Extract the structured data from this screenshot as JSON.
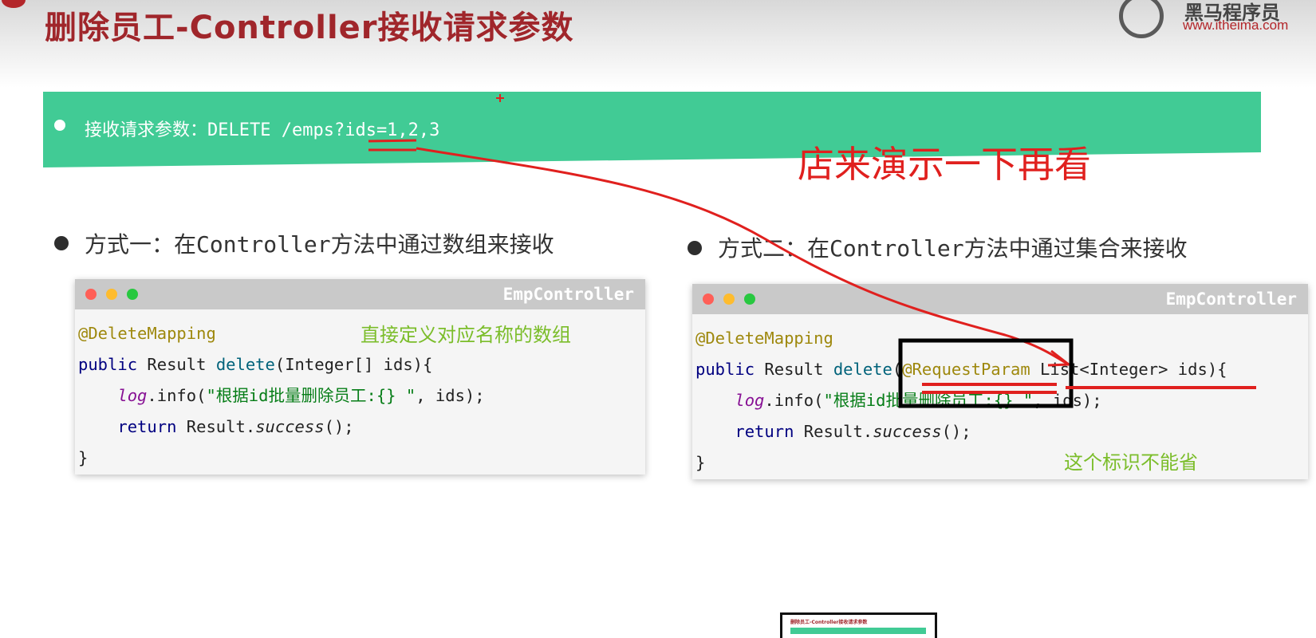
{
  "title": "删除员工-Controller接收请求参数",
  "logo": {
    "name": "黑马程序员",
    "url": "www.itheima.com"
  },
  "banner": {
    "label": "接收请求参数：DELETE",
    "path": "/emps?ids=1,2,3"
  },
  "handwritten_note": "店来演示一下再看",
  "method1": {
    "heading": "方式一：在Controller方法中通过数组来接收",
    "window_title": "EmpController",
    "note": "直接定义对应名称的数组",
    "code": {
      "annotation": "@DeleteMapping",
      "kw_public": "public",
      "type_result": " Result ",
      "method_name": "delete",
      "params": "(Integer[] ids){",
      "indent": "    ",
      "log": "log",
      "info": ".info(",
      "log_string": "\"根据id批量删除员工:{} \"",
      "log_rest": ", ids);",
      "kw_return": "return",
      "result_call": " Result.",
      "success": "success",
      "end_call": "();",
      "close_brace": "}"
    }
  },
  "method2": {
    "heading": "方式二：在Controller方法中通过集合来接收",
    "window_title": "EmpController",
    "note": "这个标识不能省",
    "code": {
      "annotation": "@DeleteMapping",
      "kw_public": "public",
      "type_result": " Result ",
      "method_name": "delete",
      "paren": "(",
      "param_annotation": "@RequestParam",
      "params": " List<Integer> ids){",
      "indent": "    ",
      "log": "log",
      "info": ".info(",
      "log_string": "\"根据id批量删除员工:{} \"",
      "log_rest": ", ids);",
      "kw_return": "return",
      "result_call": " Result.",
      "success": "success",
      "end_call": "();",
      "close_brace": "}"
    }
  },
  "thumbnail": {
    "title": "删除员工-Controller接收请求参数"
  },
  "colors": {
    "title": "#a0262b",
    "banner": "#41cb95",
    "annotation_red": "#e0201e",
    "note_green": "#7bbd2a"
  }
}
